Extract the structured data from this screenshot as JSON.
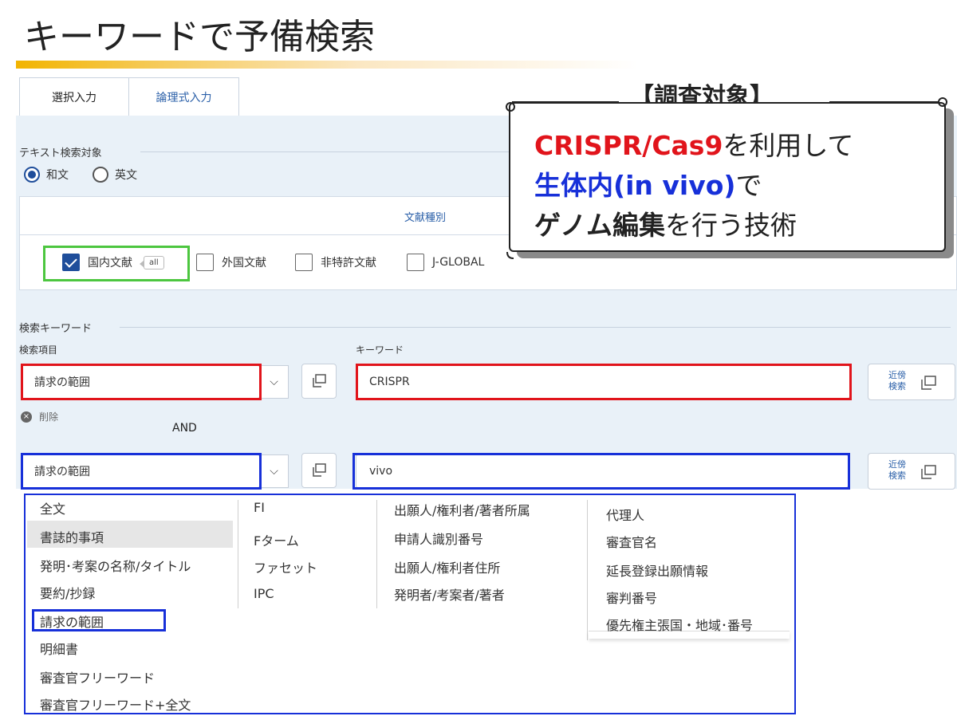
{
  "slide": {
    "title": "キーワードで予備検索"
  },
  "tabs": [
    {
      "label": "選択入力"
    },
    {
      "label": "論理式入力"
    }
  ],
  "text_target": {
    "label": "テキスト検索対象",
    "options": [
      {
        "label": "和文",
        "selected": true
      },
      {
        "label": "英文",
        "selected": false
      }
    ]
  },
  "doc_types": {
    "label": "文献種別",
    "items": [
      {
        "label": "国内文献",
        "checked": true,
        "tag": "all"
      },
      {
        "label": "外国文献",
        "checked": false
      },
      {
        "label": "非特許文献",
        "checked": false
      },
      {
        "label": "J-GLOBAL",
        "checked": false
      }
    ]
  },
  "keywords": {
    "section_label": "検索キーワード",
    "item_header": "検索項目",
    "keyword_header": "キーワード",
    "rows": [
      {
        "item": "請求の範囲",
        "keyword": "CRISPR",
        "near_label_1": "近傍",
        "near_label_2": "検索"
      },
      {
        "item": "請求の範囲",
        "keyword": "vivo",
        "near_label_1": "近傍",
        "near_label_2": "検索"
      }
    ],
    "delete_label": "削除",
    "operator": "AND"
  },
  "dropdown": {
    "col1": [
      "全文",
      "書誌的事項",
      "発明･考案の名称/タイトル",
      "要約/抄録",
      "請求の範囲",
      "明細書",
      "審査官フリーワード",
      "審査官フリーワード+全文"
    ],
    "col2": [
      "FI",
      "Fターム",
      "ファセット",
      "IPC"
    ],
    "col3": [
      "出願人/権利者/著者所属",
      "申請人識別番号",
      "出願人/権利者住所",
      "発明者/考案者/著者"
    ],
    "col4": [
      "代理人",
      "審査官名",
      "延長登録出願情報",
      "審判番号",
      "優先権主張国・地域･番号"
    ],
    "highlighted": "書誌的事項",
    "framed": "請求の範囲"
  },
  "callout": {
    "heading": "【調査対象】",
    "line1_red": "CRISPR/Cas9",
    "line1_rest": "を利用して",
    "line2_blue": "生体内(in vivo)",
    "line2_rest": "で",
    "line3_bold": "ゲノム編集",
    "line3_rest": "を行う技術"
  },
  "colors": {
    "accent_blue": "#1f4e9b",
    "frame_red": "#e1141b",
    "frame_blue": "#1730d9",
    "frame_green": "#4cc63f",
    "panel_bg": "#e9f1f8"
  }
}
